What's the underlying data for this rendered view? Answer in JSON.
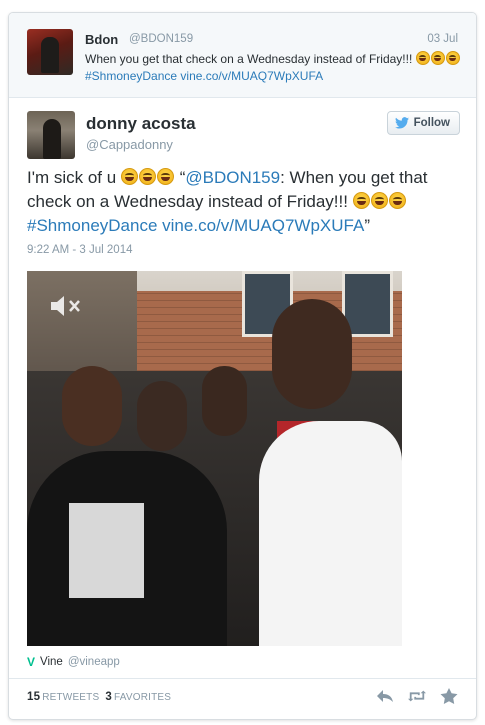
{
  "reply_tweet": {
    "name": "Bdon",
    "handle": "@BDON159",
    "date": "03 Jul",
    "text": "When you get that check on a Wednesday instead of Friday!!!",
    "hashtag": "#ShmoneyDance",
    "link": "vine.co/v/MUAQ7WpXUFA"
  },
  "main_tweet": {
    "name": "donny acosta",
    "handle": "@Cappadonny",
    "follow_label": "Follow",
    "text_prefix": "I'm sick of u",
    "quote_open": "“",
    "mention": "@BDON159",
    "quote_body": ": When you get that check on a Wednesday instead of Friday!!!",
    "hashtag": "#ShmoneyDance",
    "link": "vine.co/v/MUAQ7WpXUFA",
    "quote_close": "”",
    "timestamp": "9:22 AM - 3 Jul 2014"
  },
  "media": {
    "source_name": "Vine",
    "source_handle": "@vineapp",
    "mute_icon": "speaker-muted-icon"
  },
  "stats": {
    "retweets_count": "15",
    "retweets_label": "RETWEETS",
    "favorites_count": "3",
    "favorites_label": "FAVORITES"
  },
  "icons": [
    "reply-icon",
    "retweet-icon",
    "favorite-star-icon",
    "twitter-bird-icon",
    "vine-logo-icon"
  ],
  "colors": {
    "link": "#2b7bb9",
    "muted": "#8899a6",
    "text": "#292f33",
    "twitter_blue": "#55acee",
    "vine_green": "#00bf8f"
  }
}
